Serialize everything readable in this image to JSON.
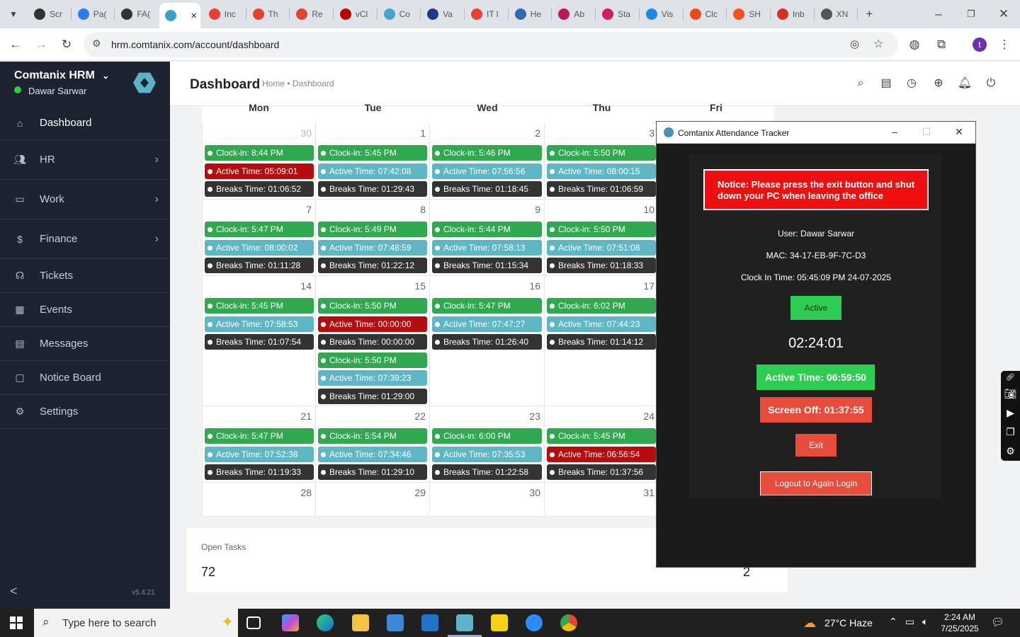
{
  "browser": {
    "tabs": [
      "Scr",
      "Pa(",
      "FA(",
      "",
      "Inc",
      "Th",
      "Re",
      "vCl",
      "Co",
      "Va",
      "IT l",
      "He",
      "Ab",
      "Sta",
      "Vis",
      "Clc",
      "SH",
      "Inb",
      "XN"
    ],
    "active_close": "✕",
    "new_tab": "+",
    "url": "hrm.comtanix.com/account/dashboard",
    "profile_initial": "t"
  },
  "sidebar": {
    "brand": "Comtanix HRM",
    "user": "Dawar Sarwar",
    "items": [
      {
        "label": "Dashboard",
        "icon": "home-icon"
      },
      {
        "label": "HR",
        "icon": "users-icon"
      },
      {
        "label": "Work",
        "icon": "briefcase-icon"
      },
      {
        "label": "Finance",
        "icon": "dollar-icon"
      },
      {
        "label": "Tickets",
        "icon": "headset-icon"
      },
      {
        "label": "Events",
        "icon": "calendar-icon"
      },
      {
        "label": "Messages",
        "icon": "message-icon"
      },
      {
        "label": "Notice Board",
        "icon": "clipboard-icon"
      },
      {
        "label": "Settings",
        "icon": "gear-icon"
      }
    ],
    "version": "v5.4.21"
  },
  "header": {
    "title": "Dashboard",
    "breadcrumb": "Home • Dashboard"
  },
  "calendar": {
    "days": [
      "Mon",
      "Tue",
      "Wed",
      "Thu",
      "Fri"
    ],
    "weeks": [
      {
        "dates": [
          "30",
          "1",
          "2",
          "3",
          ""
        ],
        "cells": [
          [
            [
              "g",
              "Clock-in: 8:44 PM"
            ],
            [
              "r",
              "Active Time: 05:09:01"
            ],
            [
              "d",
              "Breaks Time: 01:06:52"
            ]
          ],
          [
            [
              "g",
              "Clock-in: 5:45 PM"
            ],
            [
              "b",
              "Active Time: 07:42:08"
            ],
            [
              "d",
              "Breaks Time: 01:29:43"
            ]
          ],
          [
            [
              "g",
              "Clock-in: 5:46 PM"
            ],
            [
              "b",
              "Active Time: 07:56:56"
            ],
            [
              "d",
              "Breaks Time: 01:18:45"
            ]
          ],
          [
            [
              "g",
              "Clock-in: 5:50 PM"
            ],
            [
              "b",
              "Active Time: 08:00:15"
            ],
            [
              "d",
              "Breaks Time: 01:06:59"
            ]
          ],
          []
        ]
      },
      {
        "dates": [
          "7",
          "8",
          "9",
          "10",
          ""
        ],
        "cells": [
          [
            [
              "g",
              "Clock-in: 5:47 PM"
            ],
            [
              "b",
              "Active Time: 08:00:02"
            ],
            [
              "d",
              "Breaks Time: 01:11:28"
            ]
          ],
          [
            [
              "g",
              "Clock-in: 5:49 PM"
            ],
            [
              "b",
              "Active Time: 07:48:59"
            ],
            [
              "d",
              "Breaks Time: 01:22:12"
            ]
          ],
          [
            [
              "g",
              "Clock-in: 5:44 PM"
            ],
            [
              "b",
              "Active Time: 07:58:13"
            ],
            [
              "d",
              "Breaks Time: 01:15:34"
            ]
          ],
          [
            [
              "g",
              "Clock-in: 5:50 PM"
            ],
            [
              "b",
              "Active Time: 07:51:08"
            ],
            [
              "d",
              "Breaks Time: 01:18:33"
            ]
          ],
          []
        ]
      },
      {
        "dates": [
          "14",
          "15",
          "16",
          "17",
          ""
        ],
        "cells": [
          [
            [
              "g",
              "Clock-in: 5:45 PM"
            ],
            [
              "b",
              "Active Time: 07:58:53"
            ],
            [
              "d",
              "Breaks Time: 01:07:54"
            ]
          ],
          [
            [
              "g",
              "Clock-in: 5:50 PM"
            ],
            [
              "r",
              "Active Time: 00:00:00"
            ],
            [
              "d",
              "Breaks Time: 00:00:00"
            ],
            [
              "g",
              "Clock-in: 5:50 PM"
            ],
            [
              "b",
              "Active Time: 07:39:23"
            ],
            [
              "d",
              "Breaks Time: 01:29:00"
            ]
          ],
          [
            [
              "g",
              "Clock-in: 5:47 PM"
            ],
            [
              "b",
              "Active Time: 07:47:27"
            ],
            [
              "d",
              "Breaks Time: 01:26:40"
            ]
          ],
          [
            [
              "g",
              "Clock-in: 6:02 PM"
            ],
            [
              "b",
              "Active Time: 07:44:23"
            ],
            [
              "d",
              "Breaks Time: 01:14:12"
            ]
          ],
          []
        ]
      },
      {
        "dates": [
          "21",
          "22",
          "23",
          "24",
          ""
        ],
        "cells": [
          [
            [
              "g",
              "Clock-in: 5:47 PM"
            ],
            [
              "b",
              "Active Time: 07:52:38"
            ],
            [
              "d",
              "Breaks Time: 01:19:33"
            ]
          ],
          [
            [
              "g",
              "Clock-in: 5:54 PM"
            ],
            [
              "b",
              "Active Time: 07:34:46"
            ],
            [
              "d",
              "Breaks Time: 01:29:10"
            ]
          ],
          [
            [
              "g",
              "Clock-in: 6:00 PM"
            ],
            [
              "b",
              "Active Time: 07:35:53"
            ],
            [
              "d",
              "Breaks Time: 01:22:58"
            ]
          ],
          [
            [
              "g",
              "Clock-in: 5:45 PM"
            ],
            [
              "r",
              "Active Time: 06:56:54"
            ],
            [
              "d",
              "Breaks Time: 01:37:56"
            ]
          ],
          []
        ]
      },
      {
        "dates": [
          "28",
          "29",
          "30",
          "31",
          ""
        ],
        "cells": [
          [],
          [],
          [],
          [],
          []
        ]
      }
    ]
  },
  "tasks": {
    "label": "Open Tasks",
    "value": "72",
    "value2": "2"
  },
  "tracker": {
    "title": "Comtanix Attendance Tracker",
    "notice": "Notice: Please press the exit button and shut down your PC when leaving the office",
    "user": "User: Dawar Sarwar",
    "mac": "MAC: 34-17-EB-9F-7C-D3",
    "clockin": "Clock In Time: 05:45:09 PM 24-07-2025",
    "status": "Active",
    "timer": "02:24:01",
    "active_time": "Active Time: 06:59:50",
    "screen_off": "Screen Off: 01:37:55",
    "exit": "Exit",
    "logout": "Logout to Again Login"
  },
  "taskbar": {
    "search": "Type here to search",
    "weather": "27°C  Haze",
    "time": "2:24 AM",
    "date": "7/25/2025"
  }
}
